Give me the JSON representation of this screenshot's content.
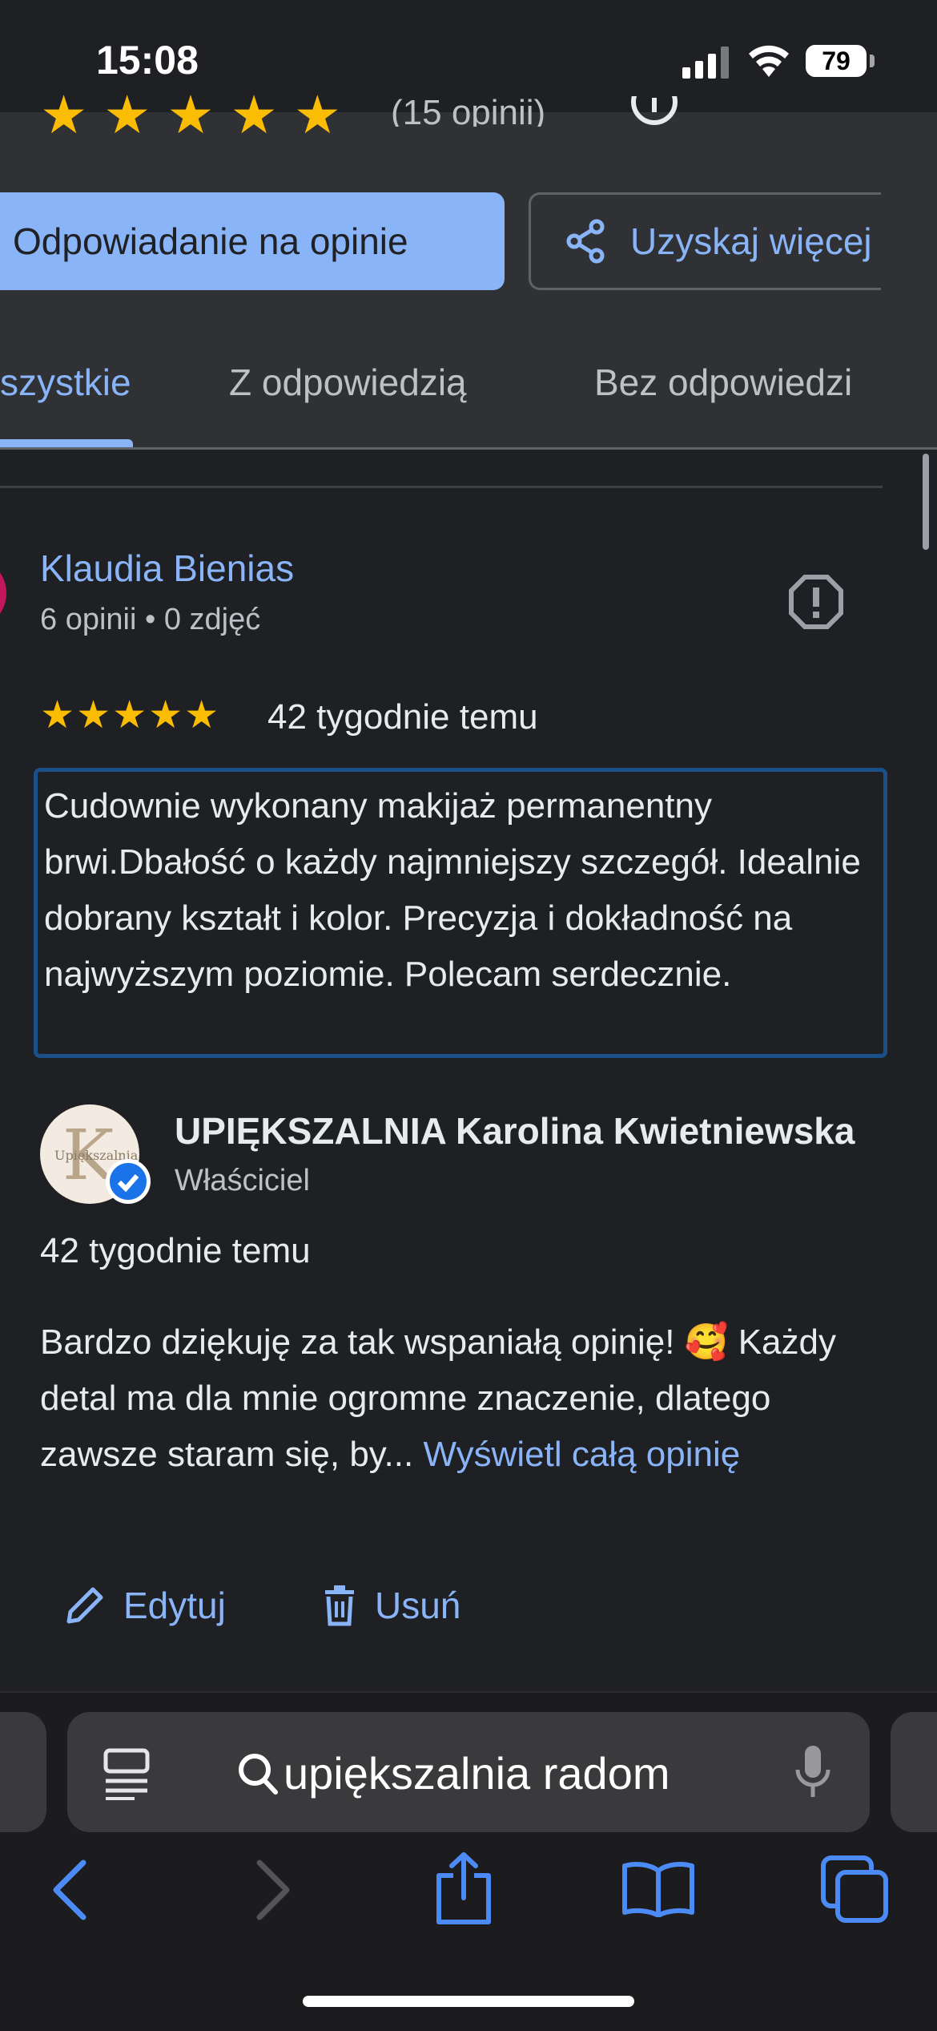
{
  "status_bar": {
    "time": "15:08",
    "battery": "79"
  },
  "header": {
    "review_count_partial": "(15 opinii)",
    "reply_button": "Odpowiadanie na opinie",
    "share_button": "Uzyskaj więcej opinii",
    "tabs": [
      {
        "label": "Wszystkie",
        "visible": "szystkie"
      },
      {
        "label": "Z odpowiedzią"
      },
      {
        "label": "Bez odpowiedzi"
      }
    ]
  },
  "review": {
    "author": "Klaudia Bienias",
    "meta": "6 opinii • 0 zdjęć",
    "stars": "★★★★★",
    "rating": 5,
    "time": "42 tygodnie temu",
    "text": "Cudownie wykonany makijaż permanentny brwi.Dbałość o każdy najmniejszy szczegół. Idealnie dobrany kształt i kolor. Precyzja i dokładność na najwyższym poziomie. Polecam serdecznie."
  },
  "owner_reply": {
    "avatar_letter": "K",
    "avatar_text": "Upiększalnia",
    "name": "UPIĘKSZALNIA Karolina Kwietniewska",
    "role": "Właściciel",
    "time": "42 tygodnie temu",
    "text": "Bardzo dziękuję za tak wspaniałą opinię! 🥰 Każdy detal ma dla mnie ogromne znaczenie, dlatego zawsze staram się, by... ",
    "more_link": "Wyświetl całą opinię",
    "edit_label": "Edytuj",
    "delete_label": "Usuń"
  },
  "browser": {
    "address": "upiększalnia radom"
  },
  "colors": {
    "accent": "#8ab4f8",
    "star": "#fbbc04",
    "background": "#1f2023",
    "panel": "#303134"
  }
}
